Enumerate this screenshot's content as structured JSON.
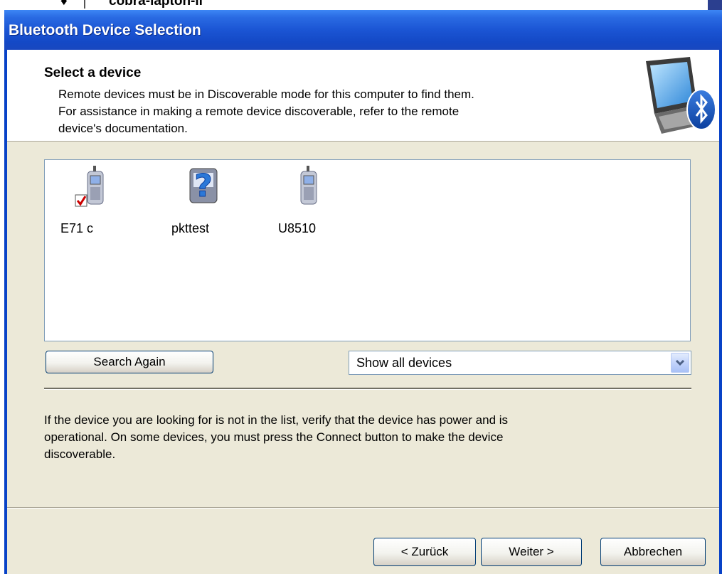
{
  "background_window": {
    "title_fragment": "cobra-lapton-ll",
    "glyph": "♦"
  },
  "dialog": {
    "title": "Bluetooth Device Selection"
  },
  "header": {
    "title": "Select a device",
    "description_lines": [
      "Remote devices must be in Discoverable mode for this computer to find them.",
      "For assistance in making a remote device discoverable, refer to the remote",
      "device's documentation."
    ],
    "icon": "bluetooth-computer-icon"
  },
  "devices": [
    {
      "label": "E71 c",
      "icon": "mobile-phone-icon",
      "checked": true
    },
    {
      "label": "pkttest",
      "icon": "unknown-device-icon",
      "checked": false
    },
    {
      "label": "U8510",
      "icon": "mobile-phone-icon",
      "checked": false
    }
  ],
  "search_button": {
    "label": "Search Again"
  },
  "filter": {
    "selected": "Show all devices"
  },
  "info_lines": [
    "If the device you are looking for is not in the list, verify that the device has power and is",
    "operational. On some devices, you must press the Connect button to make the device",
    "discoverable."
  ],
  "buttons": {
    "back": "< Zurück",
    "next": "Weiter >",
    "cancel": "Abbrechen"
  },
  "colors": {
    "titlebar": "#1b55d4",
    "dialog_face": "#ece9d8",
    "list_border": "#7f9db9",
    "checkmark": "#cc0000"
  }
}
